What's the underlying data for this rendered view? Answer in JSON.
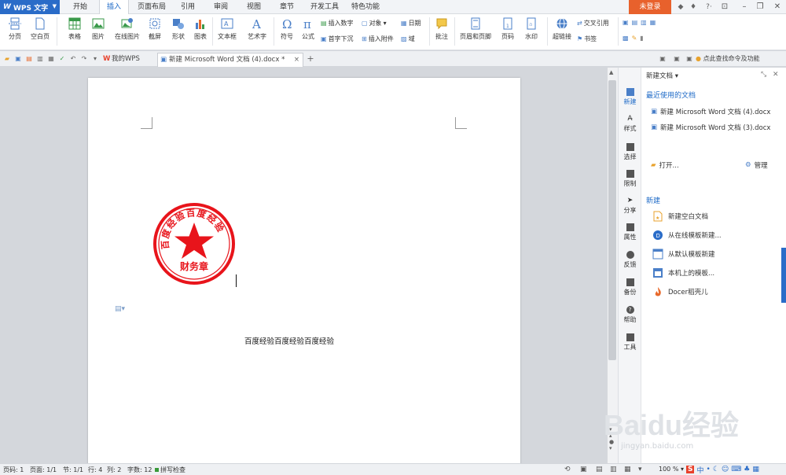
{
  "app": {
    "name": "WPS 文字",
    "login": "未登录"
  },
  "menu_tabs": [
    "开始",
    "插入",
    "页面布局",
    "引用",
    "审阅",
    "视图",
    "章节",
    "开发工具",
    "特色功能"
  ],
  "ribbon": {
    "page_break": "分页",
    "blank_page": "空白页",
    "table": "表格",
    "picture": "图片",
    "online_picture": "在线图片",
    "screenshot": "截屏",
    "shapes": "形状",
    "chart": "图表",
    "textbox": "文本框",
    "wordart": "艺术字",
    "symbol": "符号",
    "formula": "公式",
    "insert_number": "插入数字",
    "object": "对象",
    "date": "日期",
    "drop_cap": "首字下沉",
    "attachment": "插入附件",
    "field": "域",
    "comment": "批注",
    "header_footer": "页眉和页脚",
    "page_number": "页码",
    "watermark": "水印",
    "hyperlink": "超链接",
    "cross_ref": "交叉引用",
    "bookmark": "书签"
  },
  "tabbar": {
    "tab1": "我的WPS",
    "tab2": "新建 Microsoft Word 文档 (4).docx *",
    "hint": "点此查找命令及功能"
  },
  "document": {
    "stamp_text": "百度经验百度经验",
    "stamp_bottom": "财务章",
    "body_text": "百度经验百度经验百度经验"
  },
  "sidebar": {
    "items": [
      "新建",
      "样式",
      "选择",
      "限制",
      "分享",
      "属性",
      "反馈",
      "备份",
      "帮助",
      "工具"
    ]
  },
  "panel": {
    "title": "新建文档",
    "recent_heading": "最近使用的文档",
    "recent": [
      "新建 Microsoft Word 文档 (4).docx",
      "新建 Microsoft Word 文档 (3).docx"
    ],
    "open": "打开...",
    "manage": "管理",
    "new_heading": "新建",
    "new_items": [
      "新建空白文档",
      "从在线模板新建...",
      "从默认模板新建",
      "本机上的模板...",
      "Docer稻壳儿"
    ]
  },
  "status": {
    "page_num": "页码: 1",
    "pages": "页面: 1/1",
    "section": "节: 1/1",
    "row": "行: 4",
    "col": "列: 2",
    "words": "字数: 12",
    "spell": "拼写检查",
    "zoom": "100 %"
  },
  "colors": {
    "accent": "#2a6cc8",
    "login": "#e8612c",
    "stamp": "#e8141b"
  },
  "watermark": {
    "brand": "Baidu经验",
    "url": "jingyan.baidu.com"
  }
}
